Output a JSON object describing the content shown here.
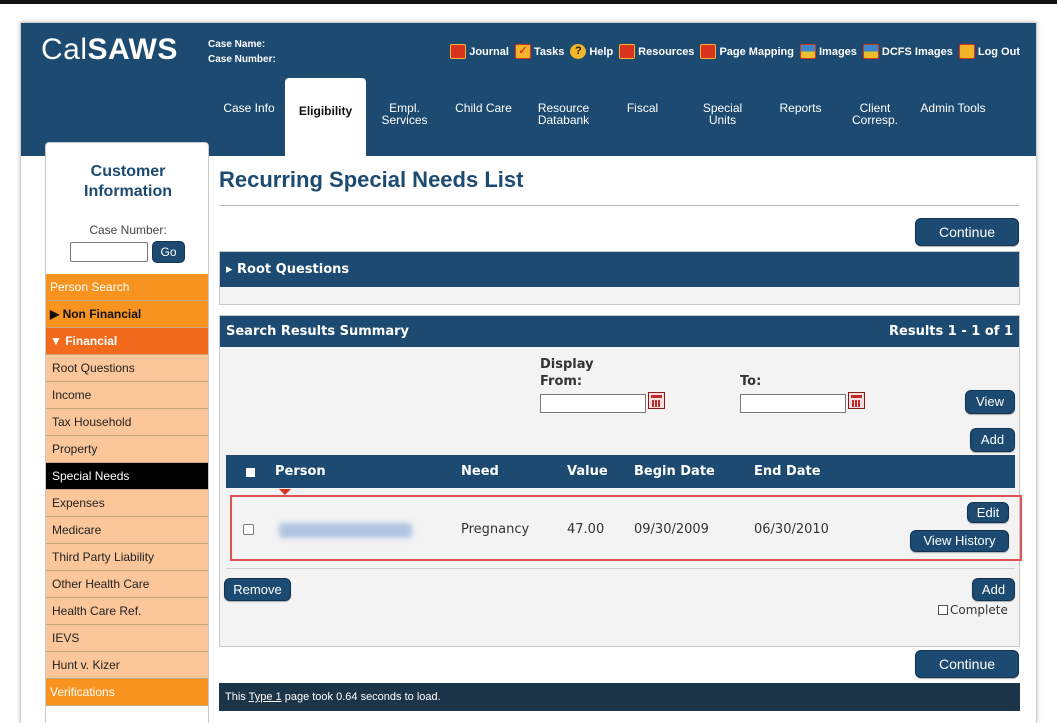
{
  "app": {
    "logo_part1": "Cal",
    "logo_part2": "SAWS"
  },
  "header": {
    "case_name_label": "Case Name:",
    "case_number_label": "Case Number:",
    "utility_links": [
      {
        "label": "Journal",
        "icon": "journal-icon"
      },
      {
        "label": "Tasks",
        "icon": "tasks-icon"
      },
      {
        "label": "Help",
        "icon": "help-icon"
      },
      {
        "label": "Resources",
        "icon": "resources-icon"
      },
      {
        "label": "Page Mapping",
        "icon": "page-mapping-icon"
      },
      {
        "label": "Images",
        "icon": "images-icon"
      },
      {
        "label": "DCFS Images",
        "icon": "dcfs-images-icon"
      },
      {
        "label": "Log Out",
        "icon": "log-out-icon"
      }
    ],
    "tabs": [
      {
        "label": "Case Info"
      },
      {
        "label": "Eligibility",
        "active": true
      },
      {
        "label": "Empl.\nServices"
      },
      {
        "label": "Child Care"
      },
      {
        "label": "Resource\nDatabank"
      },
      {
        "label": "Fiscal"
      },
      {
        "label": "Special\nUnits"
      },
      {
        "label": "Reports"
      },
      {
        "label": "Client\nCorresp."
      },
      {
        "label": "Admin Tools"
      }
    ]
  },
  "sidebar": {
    "title": "Customer\nInformation",
    "case_number_label": "Case Number:",
    "case_number_value": "",
    "go_label": "Go",
    "items": [
      {
        "label": "Person Search",
        "style": "orange"
      },
      {
        "label": "▶ Non Financial",
        "style": "bold"
      },
      {
        "label": "▼ Financial",
        "style": "boldr"
      },
      {
        "label": "Root Questions",
        "style": "sub"
      },
      {
        "label": "Income",
        "style": "sub"
      },
      {
        "label": "Tax Household",
        "style": "sub"
      },
      {
        "label": "Property",
        "style": "sub"
      },
      {
        "label": "Special Needs",
        "style": "selected"
      },
      {
        "label": "Expenses",
        "style": "sub"
      },
      {
        "label": "Medicare",
        "style": "sub"
      },
      {
        "label": "Third Party Liability",
        "style": "sub"
      },
      {
        "label": "Other Health Care",
        "style": "sub"
      },
      {
        "label": "Health Care Ref.",
        "style": "sub"
      },
      {
        "label": "IEVS",
        "style": "sub"
      },
      {
        "label": "Hunt v. Kizer",
        "style": "sub"
      },
      {
        "label": "Verifications",
        "style": "orange"
      }
    ]
  },
  "main": {
    "page_title": "Recurring Special Needs List",
    "continue_label": "Continue",
    "root_questions_label": "▸ Root Questions",
    "search_results": {
      "title": "Search Results Summary",
      "results_text": "Results 1 - 1 of 1",
      "display_from_label": "Display\nFrom:",
      "to_label": "To:",
      "from_value": "",
      "to_value": "",
      "view_label": "View",
      "add_label": "Add"
    },
    "table": {
      "headers": [
        "Person",
        "Need",
        "Value",
        "Begin Date",
        "End Date"
      ],
      "rows": [
        {
          "person": "",
          "need": "Pregnancy",
          "value": "47.00",
          "begin_date": "09/30/2009",
          "end_date": "06/30/2010",
          "edit_label": "Edit",
          "view_history_label": "View History"
        }
      ]
    },
    "remove_label": "Remove",
    "add_label": "Add",
    "complete_label": "Complete"
  },
  "footer": {
    "prefix": "This ",
    "link": "Type 1",
    "suffix": " page took 0.64 seconds to load."
  },
  "colors": {
    "primary": "#1c4a70",
    "accent_orange": "#f7931e",
    "highlight": "#e05252"
  }
}
